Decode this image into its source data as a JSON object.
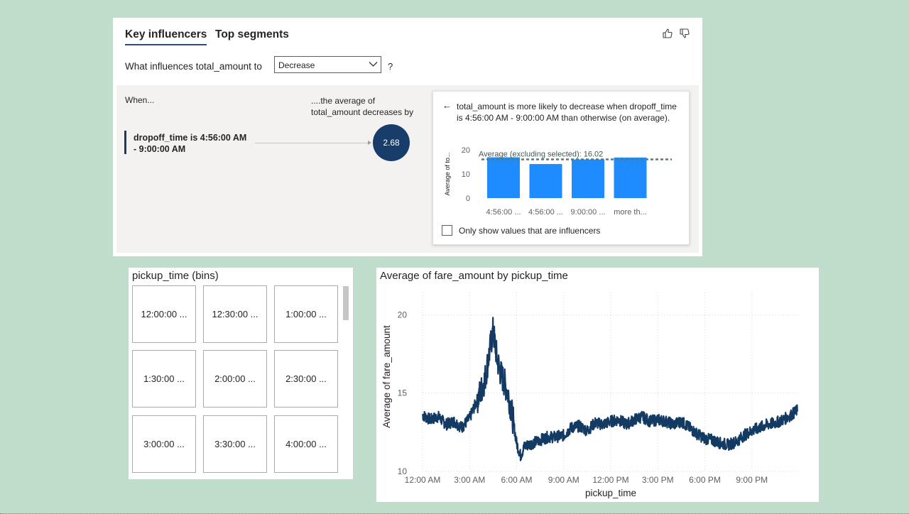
{
  "key_influencers": {
    "tabs": [
      "Key influencers",
      "Top segments"
    ],
    "question_label": "What influences total_amount to",
    "dropdown_value": "Decrease",
    "question_mark": "?",
    "when_label": "When...",
    "avg_header": "....the average of total_amount decreases by",
    "influencer_text": "dropoff_time is 4:56:00 AM - 9:00:00 AM",
    "influencer_value": "2.68",
    "detail": {
      "back_arrow": "←",
      "text": "total_amount is more likely to decrease when dropoff_time is 4:56:00 AM - 9:00:00 AM than otherwise (on average).",
      "checkbox_label": "Only show values that are influencers"
    },
    "colors": {
      "accent": "#1f3b63",
      "bubble": "#183d6b",
      "bar": "#1e8cff"
    }
  },
  "slicer": {
    "title": "pickup_time (bins)",
    "items": [
      "12:00:00 ...",
      "12:30:00 ...",
      "1:00:00 ...",
      "1:30:00 ...",
      "2:00:00 ...",
      "2:30:00 ...",
      "3:00:00 ...",
      "3:30:00 ...",
      "4:00:00 ..."
    ]
  },
  "line_chart": {
    "title": "Average of fare_amount by pickup_time"
  },
  "chart_data": [
    {
      "type": "bar",
      "ylabel": "Average of to...",
      "categories": [
        "4:56:00 ...",
        "4:56:00 ...",
        "9:00:00 ...",
        "more th..."
      ],
      "values": [
        16.9,
        14.1,
        16.0,
        16.8
      ],
      "ylim": [
        0,
        20
      ],
      "yticks": [
        0,
        10,
        20
      ],
      "reference_line": {
        "label": "Average (excluding selected): 16.02",
        "value": 16.02
      },
      "color": "#1e8cff"
    },
    {
      "type": "line",
      "xlabel": "pickup_time",
      "ylabel": "Average of fare_amount",
      "xticks": [
        "12:00 AM",
        "3:00 AM",
        "6:00 AM",
        "9:00 AM",
        "12:00 PM",
        "3:00 PM",
        "6:00 PM",
        "9:00 PM"
      ],
      "xlim_hours": [
        0,
        24
      ],
      "ylim": [
        10,
        21.2
      ],
      "yticks": [
        10,
        15,
        20
      ],
      "grid": true,
      "color": "#123a63",
      "series": [
        {
          "x_hours": [
            0,
            0.5,
            1,
            1.5,
            2,
            2.5,
            3,
            3.25,
            3.5,
            3.75,
            4,
            4.25,
            4.5,
            4.75,
            5,
            5.25,
            5.5,
            5.75,
            6,
            6.25,
            6.5,
            7,
            7.5,
            8,
            8.5,
            9,
            9.5,
            10,
            10.5,
            11,
            11.5,
            12,
            12.5,
            13,
            13.5,
            14,
            14.5,
            15,
            15.5,
            16,
            16.5,
            17,
            17.5,
            18,
            18.5,
            19,
            19.5,
            20,
            20.5,
            21,
            21.5,
            22,
            22.5,
            23,
            23.5,
            23.9
          ],
          "values": [
            13.6,
            13.3,
            13.5,
            13.0,
            13.2,
            12.8,
            13.4,
            14.0,
            14.6,
            15.2,
            16.0,
            17.5,
            19.0,
            17.2,
            16.2,
            15.6,
            14.8,
            13.4,
            11.8,
            11.0,
            11.6,
            11.8,
            12.0,
            12.2,
            12.2,
            12.3,
            12.8,
            12.9,
            12.6,
            13.1,
            13.0,
            13.2,
            13.3,
            13.0,
            13.3,
            13.5,
            13.2,
            13.3,
            13.2,
            13.0,
            13.2,
            12.8,
            12.4,
            12.1,
            12.0,
            11.8,
            11.7,
            11.9,
            12.3,
            12.6,
            12.8,
            13.0,
            13.1,
            13.3,
            13.6,
            13.9
          ]
        }
      ]
    }
  ]
}
